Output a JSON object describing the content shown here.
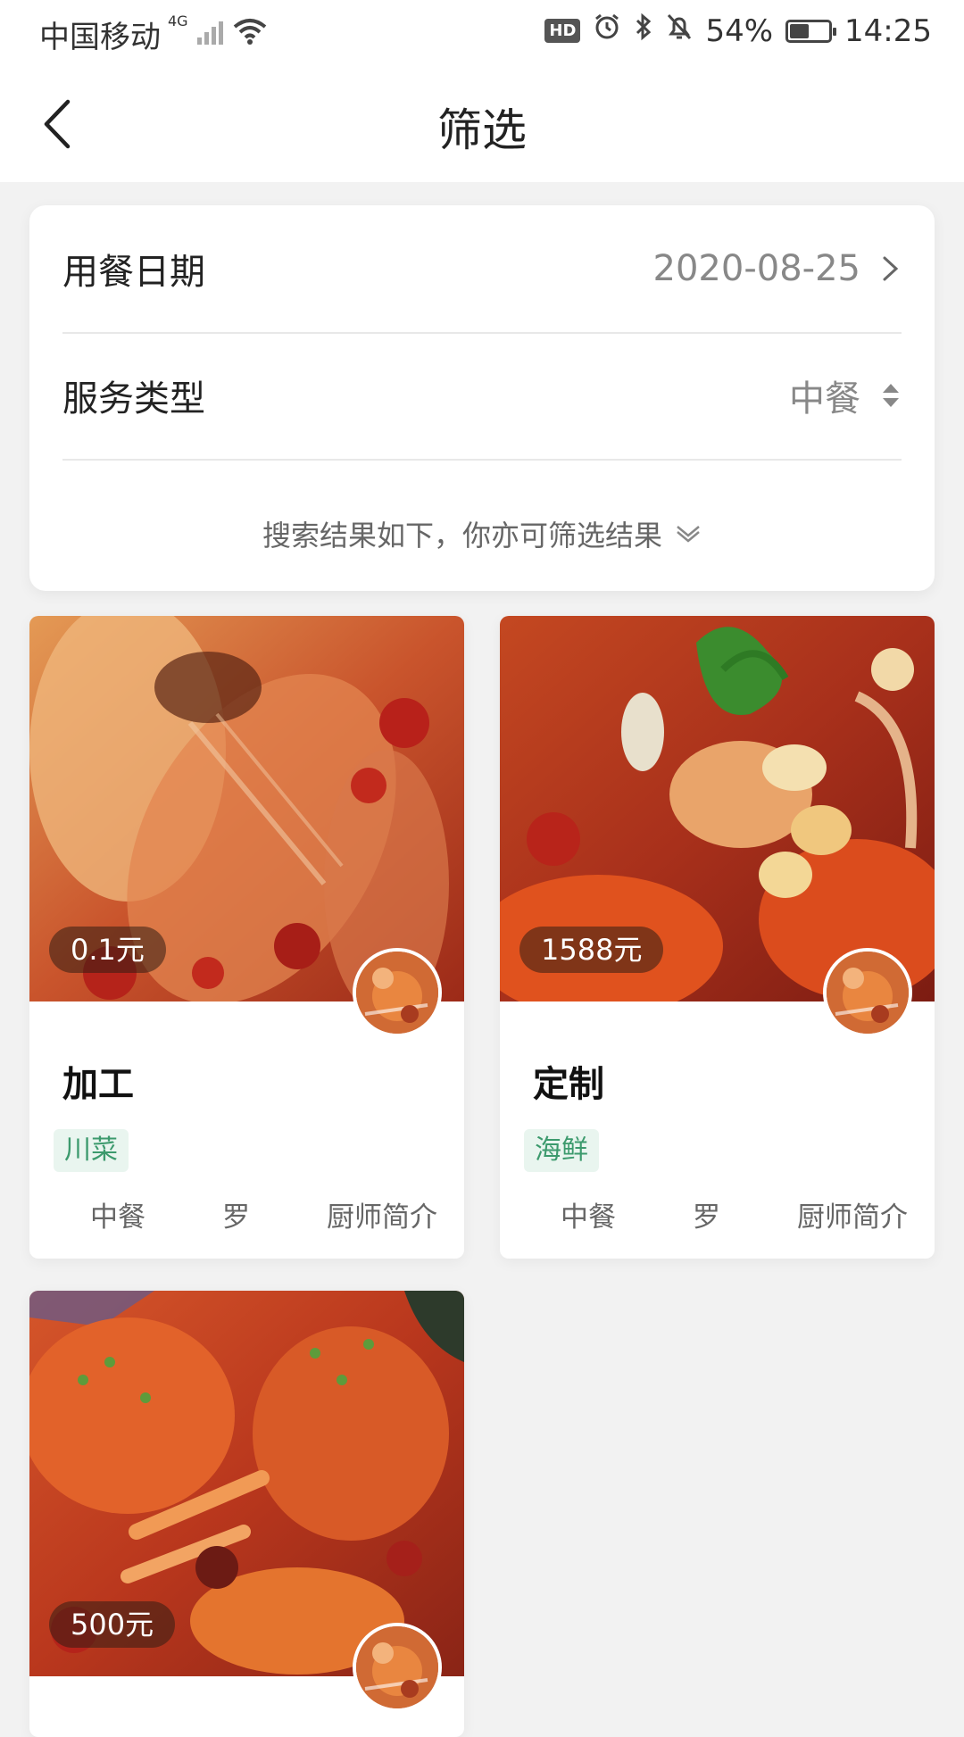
{
  "status_bar": {
    "carrier": "中国移动",
    "network": "4G",
    "battery": "54%",
    "battery_level": 0.54,
    "time": "14:25",
    "hd_label": "HD"
  },
  "header": {
    "title": "筛选",
    "back_icon": "chevron-left-icon"
  },
  "filters": {
    "date_label": "用餐日期",
    "date_value": "2020-08-25",
    "service_label": "服务类型",
    "service_value": "中餐",
    "hint": "搜索结果如下，你亦可筛选结果"
  },
  "products": [
    {
      "price": "0.1元",
      "name": "加工",
      "tag": "川菜",
      "cuisine": "中餐",
      "chef": "罗",
      "intro": "厨师简介"
    },
    {
      "price": "1588元",
      "name": "定制",
      "tag": "海鲜",
      "cuisine": "中餐",
      "chef": "罗",
      "intro": "厨师简介"
    },
    {
      "price": "500元"
    }
  ],
  "colors": {
    "tag_bg": "#e9f5ef",
    "tag_text": "#3c9a6d",
    "page_bg": "#f2f2f2"
  }
}
